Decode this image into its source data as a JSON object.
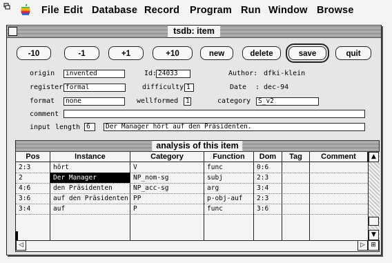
{
  "menubar": {
    "items": [
      "File",
      "Edit",
      "Database",
      "Record",
      "Program",
      "Run",
      "Window",
      "Browse"
    ]
  },
  "window": {
    "title": "tsdb: item"
  },
  "toolbar": {
    "buttons": [
      "-10",
      "-1",
      "+1",
      "+10",
      "new",
      "delete",
      "save",
      "quit"
    ]
  },
  "form": {
    "origin_label": "origin",
    "origin_value": "invented",
    "id_label": "Id:",
    "id_value": "24033",
    "author_label": "Author:",
    "author_value": "dfki-klein",
    "register_label": "register",
    "register_value": "formal",
    "difficulty_label": "difficulty",
    "difficulty_value": "1",
    "date_label": "Date",
    "date_value": ": dec-94",
    "format_label": "format",
    "format_value": "none",
    "wellformed_label": "wellformed",
    "wellformed_value": "1",
    "category_label": "category",
    "category_value": "S_v2",
    "comment_label": "comment",
    "comment_value": "",
    "input_label": "input",
    "length_label": "length",
    "length_value": "6",
    "input_value": "Der Manager hört auf den Präsidenten."
  },
  "analysis": {
    "title": "analysis of this item",
    "columns": [
      "Pos",
      "Instance",
      "Category",
      "Function",
      "Dom",
      "Tag",
      "Comment"
    ],
    "rows": [
      [
        "2:3",
        "hört",
        "V",
        "func",
        "0:6",
        "",
        ""
      ],
      [
        "2",
        "Der Manager",
        "NP_nom-sg",
        "subj",
        "2:3",
        "",
        ""
      ],
      [
        "4:6",
        "den Präsidenten",
        "NP_acc-sg",
        "arg",
        "3:4",
        "",
        ""
      ],
      [
        "3:6",
        "auf den Präsidenten",
        "PP",
        "p-obj-auf",
        "2:3",
        "",
        ""
      ],
      [
        "3:4",
        "auf",
        "P",
        "func",
        "3:6",
        "",
        ""
      ]
    ],
    "selected_row": 1
  },
  "colors": {
    "background": "#f4f4f4",
    "window": "#e6e6e6",
    "selection": "#000000"
  }
}
